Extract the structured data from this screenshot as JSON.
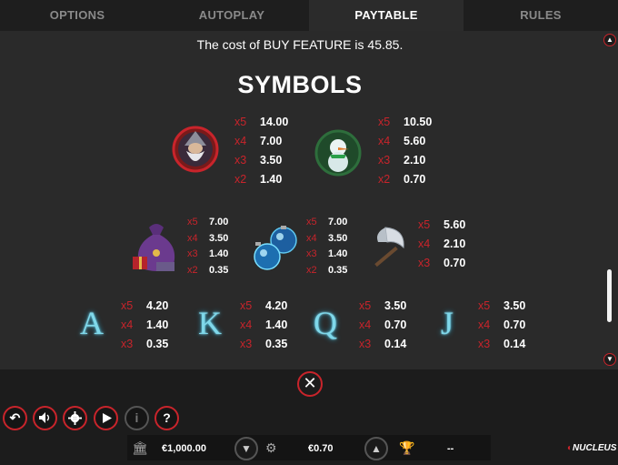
{
  "tabs": [
    {
      "label": "OPTIONS"
    },
    {
      "label": "AUTOPLAY"
    },
    {
      "label": "PAYTABLE"
    },
    {
      "label": "RULES"
    }
  ],
  "active_tab": "PAYTABLE",
  "cost_text": "The cost of BUY FEATURE is 45.85.",
  "symbols_title": "SYMBOLS",
  "paytable": {
    "wizard": {
      "icon": "wizard-icon",
      "rows": [
        {
          "m": "x5",
          "v": "14.00"
        },
        {
          "m": "x4",
          "v": "7.00"
        },
        {
          "m": "x3",
          "v": "3.50"
        },
        {
          "m": "x2",
          "v": "1.40"
        }
      ]
    },
    "snowman": {
      "icon": "snowman-icon",
      "rows": [
        {
          "m": "x5",
          "v": "10.50"
        },
        {
          "m": "x4",
          "v": "5.60"
        },
        {
          "m": "x3",
          "v": "2.10"
        },
        {
          "m": "x2",
          "v": "0.70"
        }
      ]
    },
    "sack": {
      "icon": "gift-sack-icon",
      "rows": [
        {
          "m": "x5",
          "v": "7.00"
        },
        {
          "m": "x4",
          "v": "3.50"
        },
        {
          "m": "x3",
          "v": "1.40"
        },
        {
          "m": "x2",
          "v": "0.35"
        }
      ]
    },
    "ornaments": {
      "icon": "ornaments-icon",
      "rows": [
        {
          "m": "x5",
          "v": "7.00"
        },
        {
          "m": "x4",
          "v": "3.50"
        },
        {
          "m": "x3",
          "v": "1.40"
        },
        {
          "m": "x2",
          "v": "0.35"
        }
      ]
    },
    "axe": {
      "icon": "axe-icon",
      "rows": [
        {
          "m": "x5",
          "v": "5.60"
        },
        {
          "m": "x4",
          "v": "2.10"
        },
        {
          "m": "x3",
          "v": "0.70"
        }
      ]
    },
    "A": {
      "letter": "A",
      "rows": [
        {
          "m": "x5",
          "v": "4.20"
        },
        {
          "m": "x4",
          "v": "1.40"
        },
        {
          "m": "x3",
          "v": "0.35"
        }
      ]
    },
    "K": {
      "letter": "K",
      "rows": [
        {
          "m": "x5",
          "v": "4.20"
        },
        {
          "m": "x4",
          "v": "1.40"
        },
        {
          "m": "x3",
          "v": "0.35"
        }
      ]
    },
    "Q": {
      "letter": "Q",
      "rows": [
        {
          "m": "x5",
          "v": "3.50"
        },
        {
          "m": "x4",
          "v": "0.70"
        },
        {
          "m": "x3",
          "v": "0.14"
        }
      ]
    },
    "J": {
      "letter": "J",
      "rows": [
        {
          "m": "x5",
          "v": "3.50"
        },
        {
          "m": "x4",
          "v": "0.70"
        },
        {
          "m": "x3",
          "v": "0.14"
        }
      ]
    }
  },
  "controls": {
    "back": "↶",
    "sound": "sound-icon",
    "settings": "gear-icon",
    "play": "play-icon",
    "info": "i",
    "help": "?"
  },
  "bottom_bar": {
    "balance": "€1,000.00",
    "bet": "€0.70",
    "win": "--"
  },
  "brand": "NUCLEUS",
  "colors": {
    "accent": "#c8242b",
    "panel": "#2a2a2a",
    "background": "#1c1c1c"
  }
}
